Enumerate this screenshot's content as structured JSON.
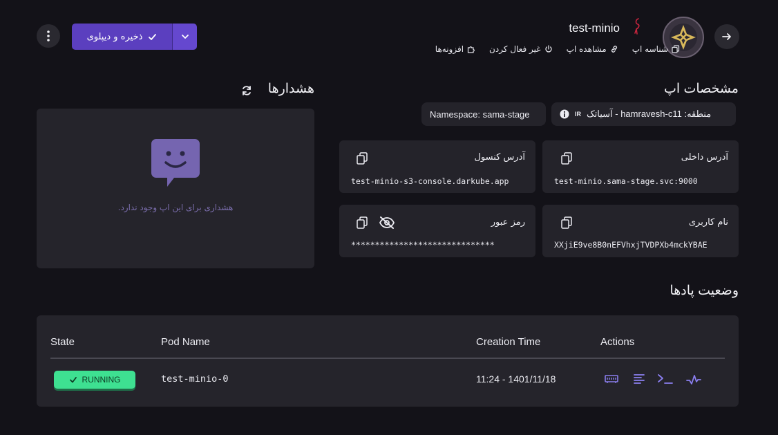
{
  "header": {
    "app_name": "test-minio",
    "links": [
      {
        "label": "شناسه اپ",
        "icon": "copy-icon"
      },
      {
        "label": "مشاهده اپ",
        "icon": "link-icon"
      },
      {
        "label": "غیر فعال کردن",
        "icon": "power-icon"
      },
      {
        "label": "افزونه‌ها",
        "icon": "puzzle-icon"
      }
    ],
    "save_label": "ذخیره و دیپلوی"
  },
  "app_specs": {
    "title": "مشخصات اپ",
    "region_label": "منطقه: hamravesh-c11 - آسیاتک",
    "region_flag": "IR",
    "namespace": "Namespace: sama-stage",
    "cards": [
      {
        "label": "آدرس داخلی",
        "value": "test-minio.sama-stage.svc:9000"
      },
      {
        "label": "آدرس کنسول",
        "value": "test-minio-s3-console.darkube.app"
      },
      {
        "label": "نام کاربری",
        "value": "XXjiE9ve8B0nEFVhxjTVDPXb4mckYBAE"
      },
      {
        "label": "رمز عبور",
        "value": "******************************"
      }
    ]
  },
  "alerts": {
    "title": "هشدارها",
    "empty_text": "هشداری برای این اپ وجود ندارد."
  },
  "pods": {
    "title": "وضعیت پادها",
    "columns": [
      "State",
      "Pod Name",
      "Creation Time",
      "Actions"
    ],
    "rows": [
      {
        "state": "RUNNING",
        "name": "test-minio-0",
        "created": "11:24 - 1401/11/18"
      }
    ]
  },
  "colors": {
    "accent": "#5b3fbf",
    "running": "#3ee091",
    "action_icon": "#8b7ff0"
  }
}
